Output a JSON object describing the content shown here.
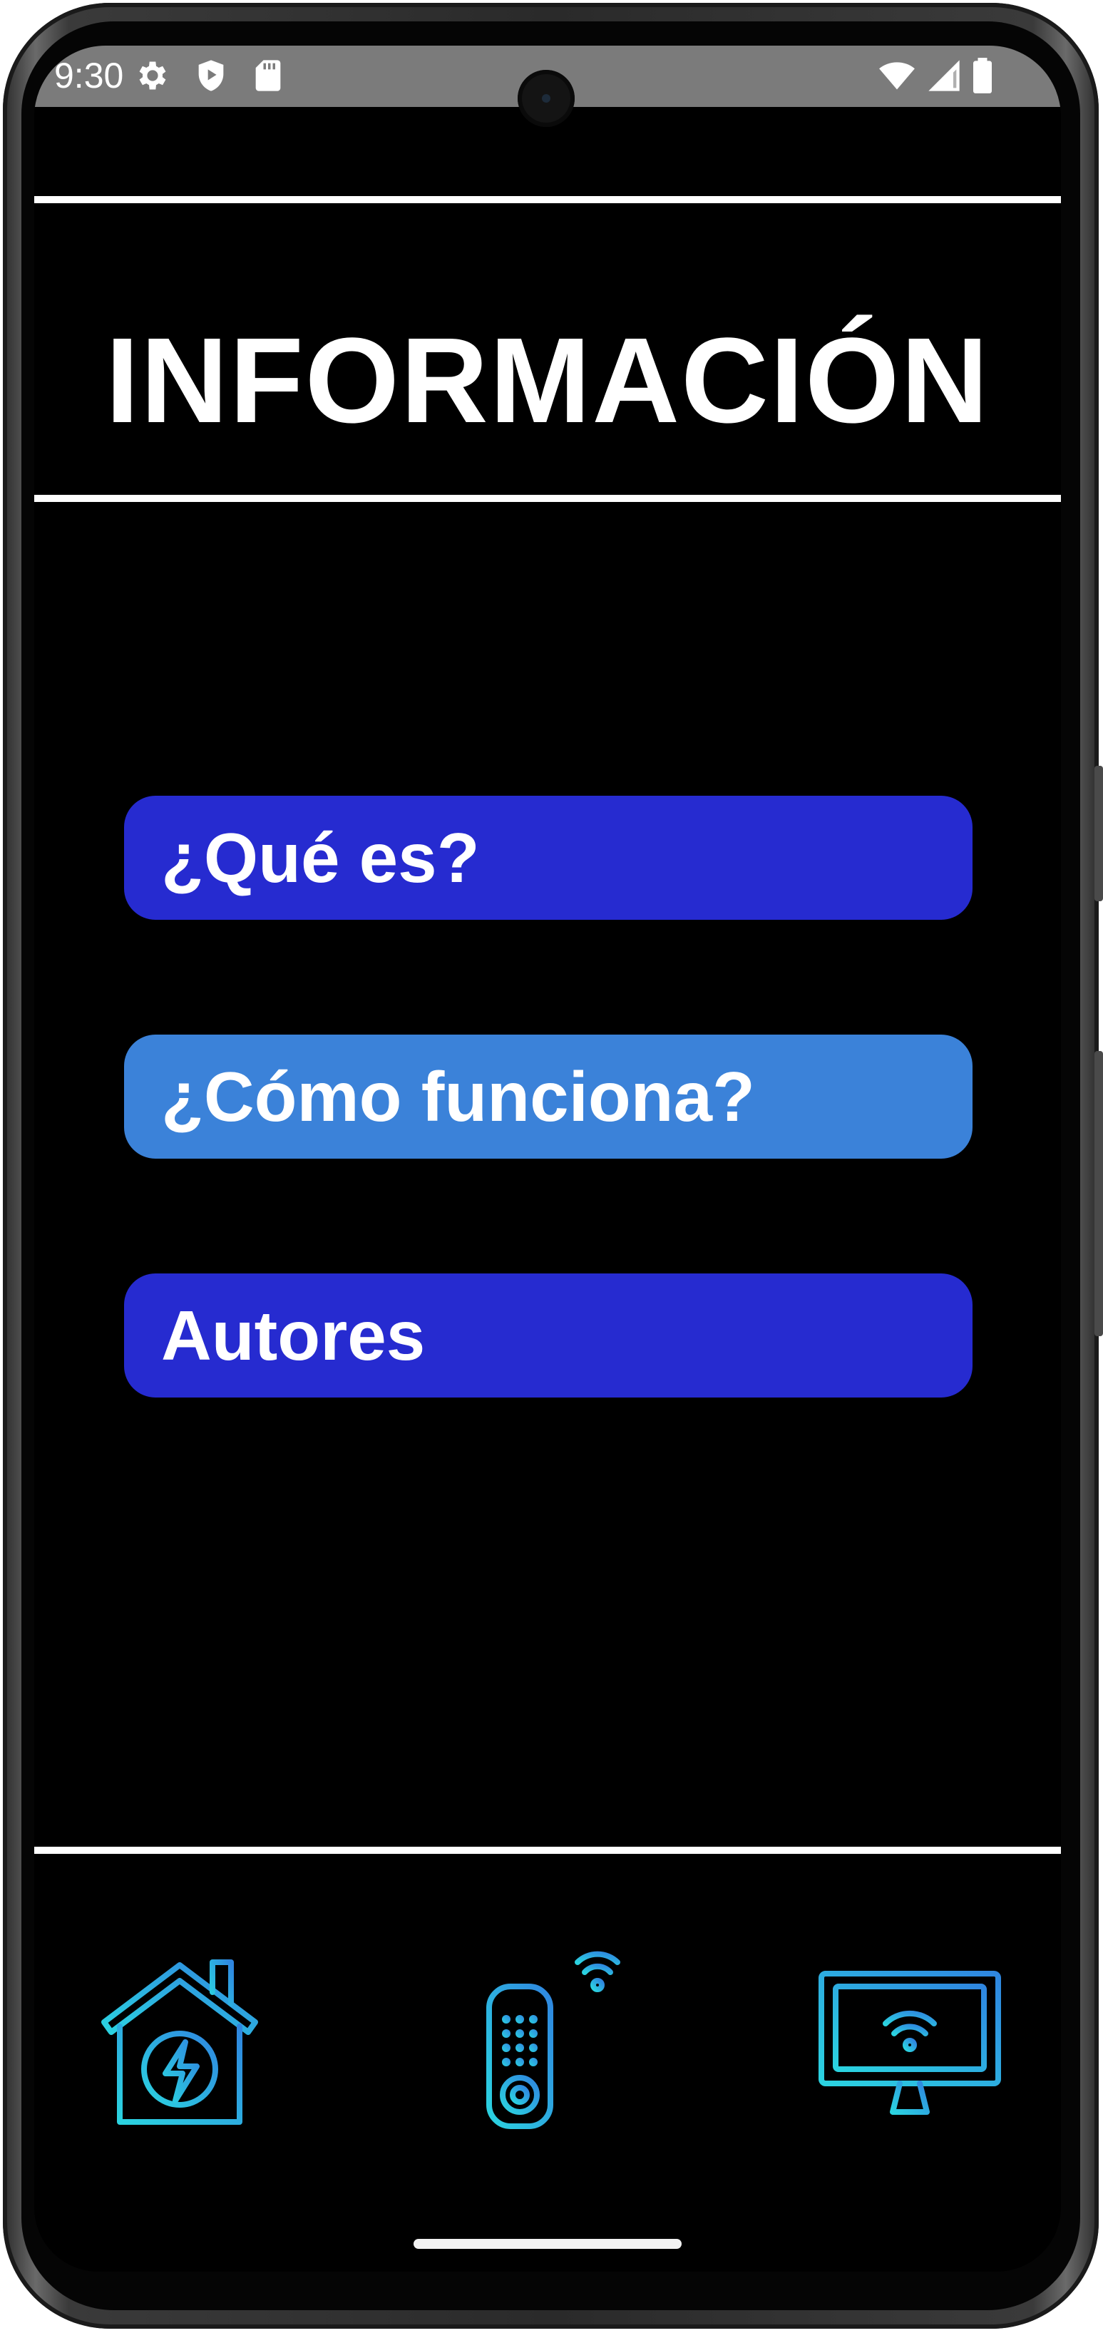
{
  "status_bar": {
    "time": "9:30",
    "icons": [
      "gear-icon",
      "shield-play-icon",
      "sd-card-icon",
      "wifi-icon",
      "signal-icon",
      "battery-icon"
    ]
  },
  "page": {
    "title": "INFORMACIÓN"
  },
  "menu": {
    "items": [
      {
        "label": "¿Qué es?",
        "color": "#262bd0"
      },
      {
        "label": "¿Cómo funciona?",
        "color": "#3b82d9"
      },
      {
        "label": "Autores",
        "color": "#262bd0"
      }
    ]
  },
  "bottom_nav": {
    "items": [
      "smart-home-icon",
      "wifi-remote-icon",
      "smart-tv-icon"
    ],
    "accent_gradient": [
      "#2bd3e0",
      "#2f86e0"
    ]
  },
  "colors": {
    "background": "#000000",
    "status_bar": "#7b7b7b",
    "divider": "#ffffff"
  }
}
